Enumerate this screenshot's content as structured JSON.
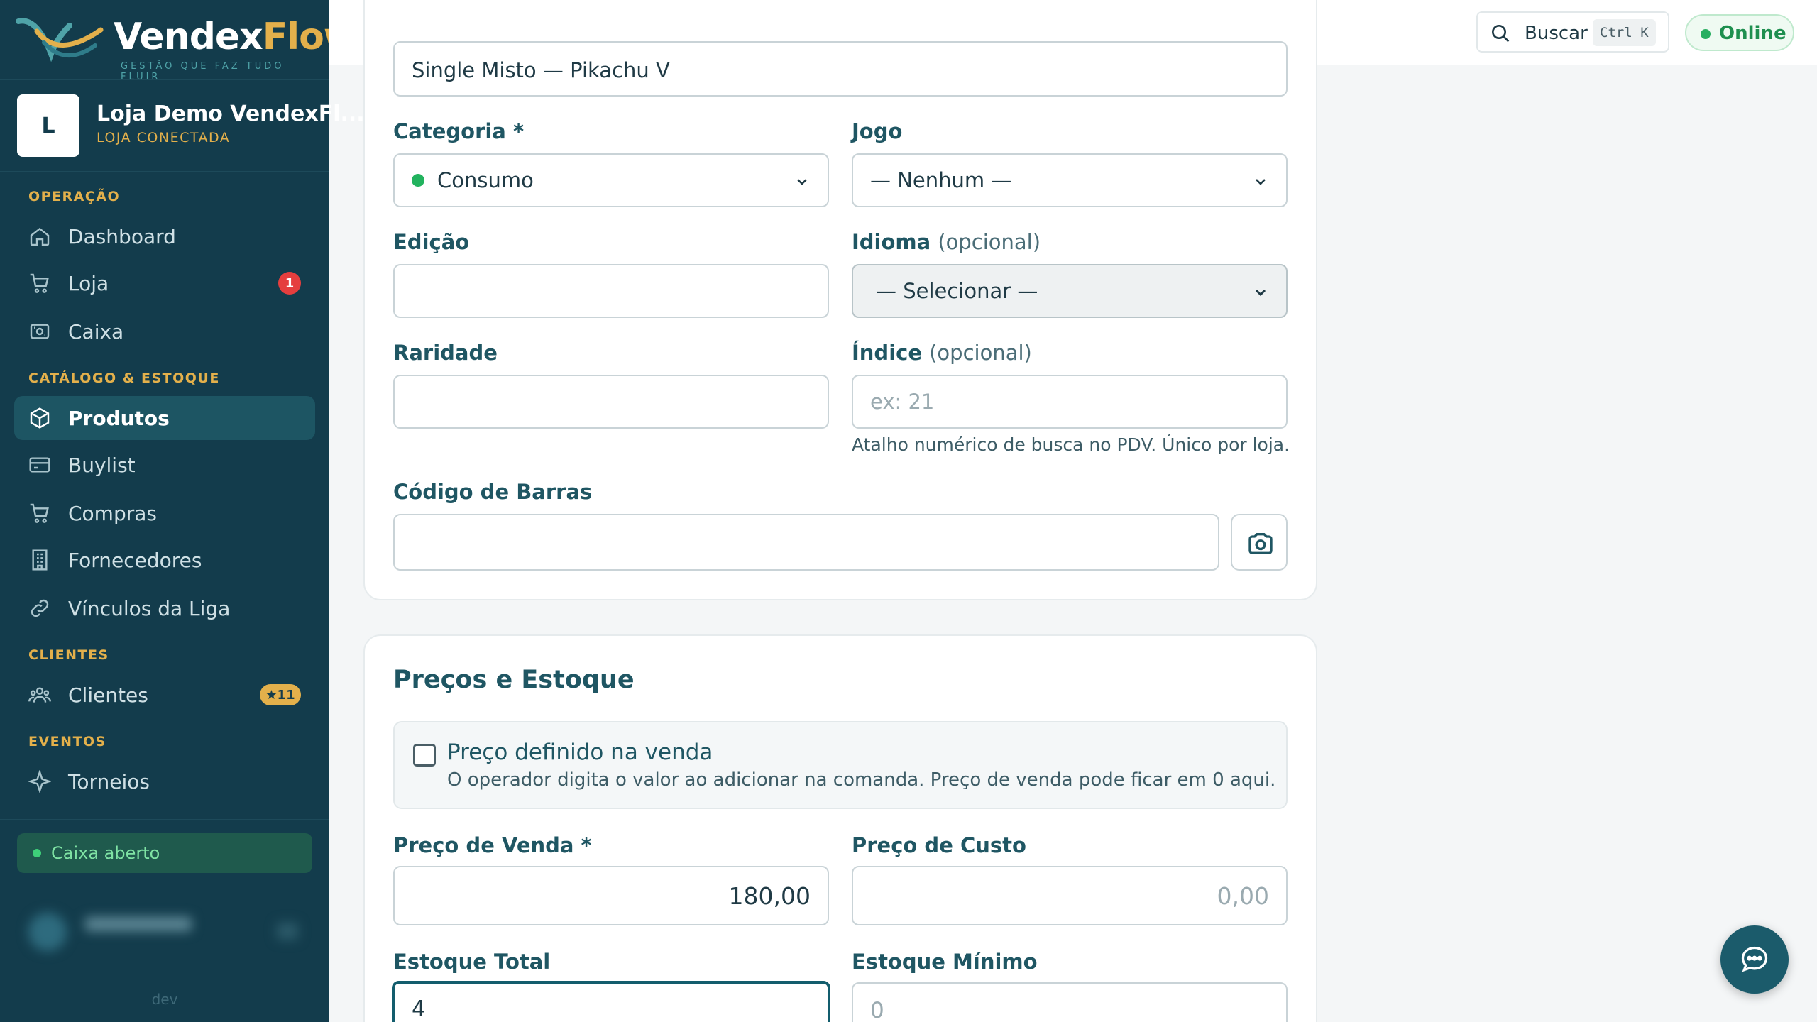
{
  "brand": {
    "name_part1": "Vendex",
    "name_part2": "Flow",
    "tagline": "GESTÃO QUE FAZ TUDO FLUIR"
  },
  "store": {
    "initial": "L",
    "name": "Loja Demo VendexFl...",
    "status": "LOJA CONECTADA"
  },
  "sidebar": {
    "sections": [
      {
        "title": "OPERAÇÃO"
      },
      {
        "title": "CATÁLOGO & ESTOQUE"
      },
      {
        "title": "CLIENTES"
      },
      {
        "title": "EVENTOS"
      }
    ],
    "items": [
      {
        "label": "Dashboard",
        "icon": "home-icon"
      },
      {
        "label": "Loja",
        "icon": "cart-icon",
        "badge": "1"
      },
      {
        "label": "Caixa",
        "icon": "cash-register-icon"
      },
      {
        "label": "Produtos",
        "icon": "box-icon",
        "active": true
      },
      {
        "label": "Buylist",
        "icon": "card-icon"
      },
      {
        "label": "Compras",
        "icon": "cart-icon"
      },
      {
        "label": "Fornecedores",
        "icon": "building-icon"
      },
      {
        "label": "Vínculos da Liga",
        "icon": "link-icon"
      },
      {
        "label": "Clientes",
        "icon": "users-icon",
        "badge": "★11"
      },
      {
        "label": "Torneios",
        "icon": "sparkle-icon"
      }
    ],
    "cash_status": "Caixa aberto",
    "env_label": "dev"
  },
  "topbar": {
    "search_label": "Buscar",
    "shortcut": "Ctrl K",
    "status": "Online"
  },
  "form": {
    "name_value": "Single Misto — Pikachu V",
    "category": {
      "label": "Categoria *",
      "value": "Consumo",
      "dot_color": "#22b35e"
    },
    "game": {
      "label": "Jogo",
      "value": "— Nenhum —"
    },
    "edition": {
      "label": "Edição",
      "value": ""
    },
    "language": {
      "label": "Idioma",
      "label_opt": "(opcional)",
      "value": "— Selecionar —"
    },
    "rarity": {
      "label": "Raridade",
      "value": ""
    },
    "index": {
      "label": "Índice",
      "label_opt": "(opcional)",
      "placeholder": "ex: 21",
      "help": "Atalho numérico de busca no PDV. Único por loja."
    },
    "barcode": {
      "label": "Código de Barras",
      "value": ""
    }
  },
  "pricing": {
    "title": "Preços e Estoque",
    "price_at_sale": {
      "label": "Preço definido na venda",
      "description": "O operador digita o valor ao adicionar na comanda. Preço de venda pode ficar em 0 aqui.",
      "checked": false
    },
    "sale_price": {
      "label": "Preço de Venda *",
      "value": "180,00"
    },
    "cost_price": {
      "label": "Preço de Custo",
      "placeholder": "0,00"
    },
    "stock_total": {
      "label": "Estoque Total",
      "value": "4"
    },
    "stock_min": {
      "label": "Estoque Mínimo",
      "placeholder": "0"
    }
  }
}
